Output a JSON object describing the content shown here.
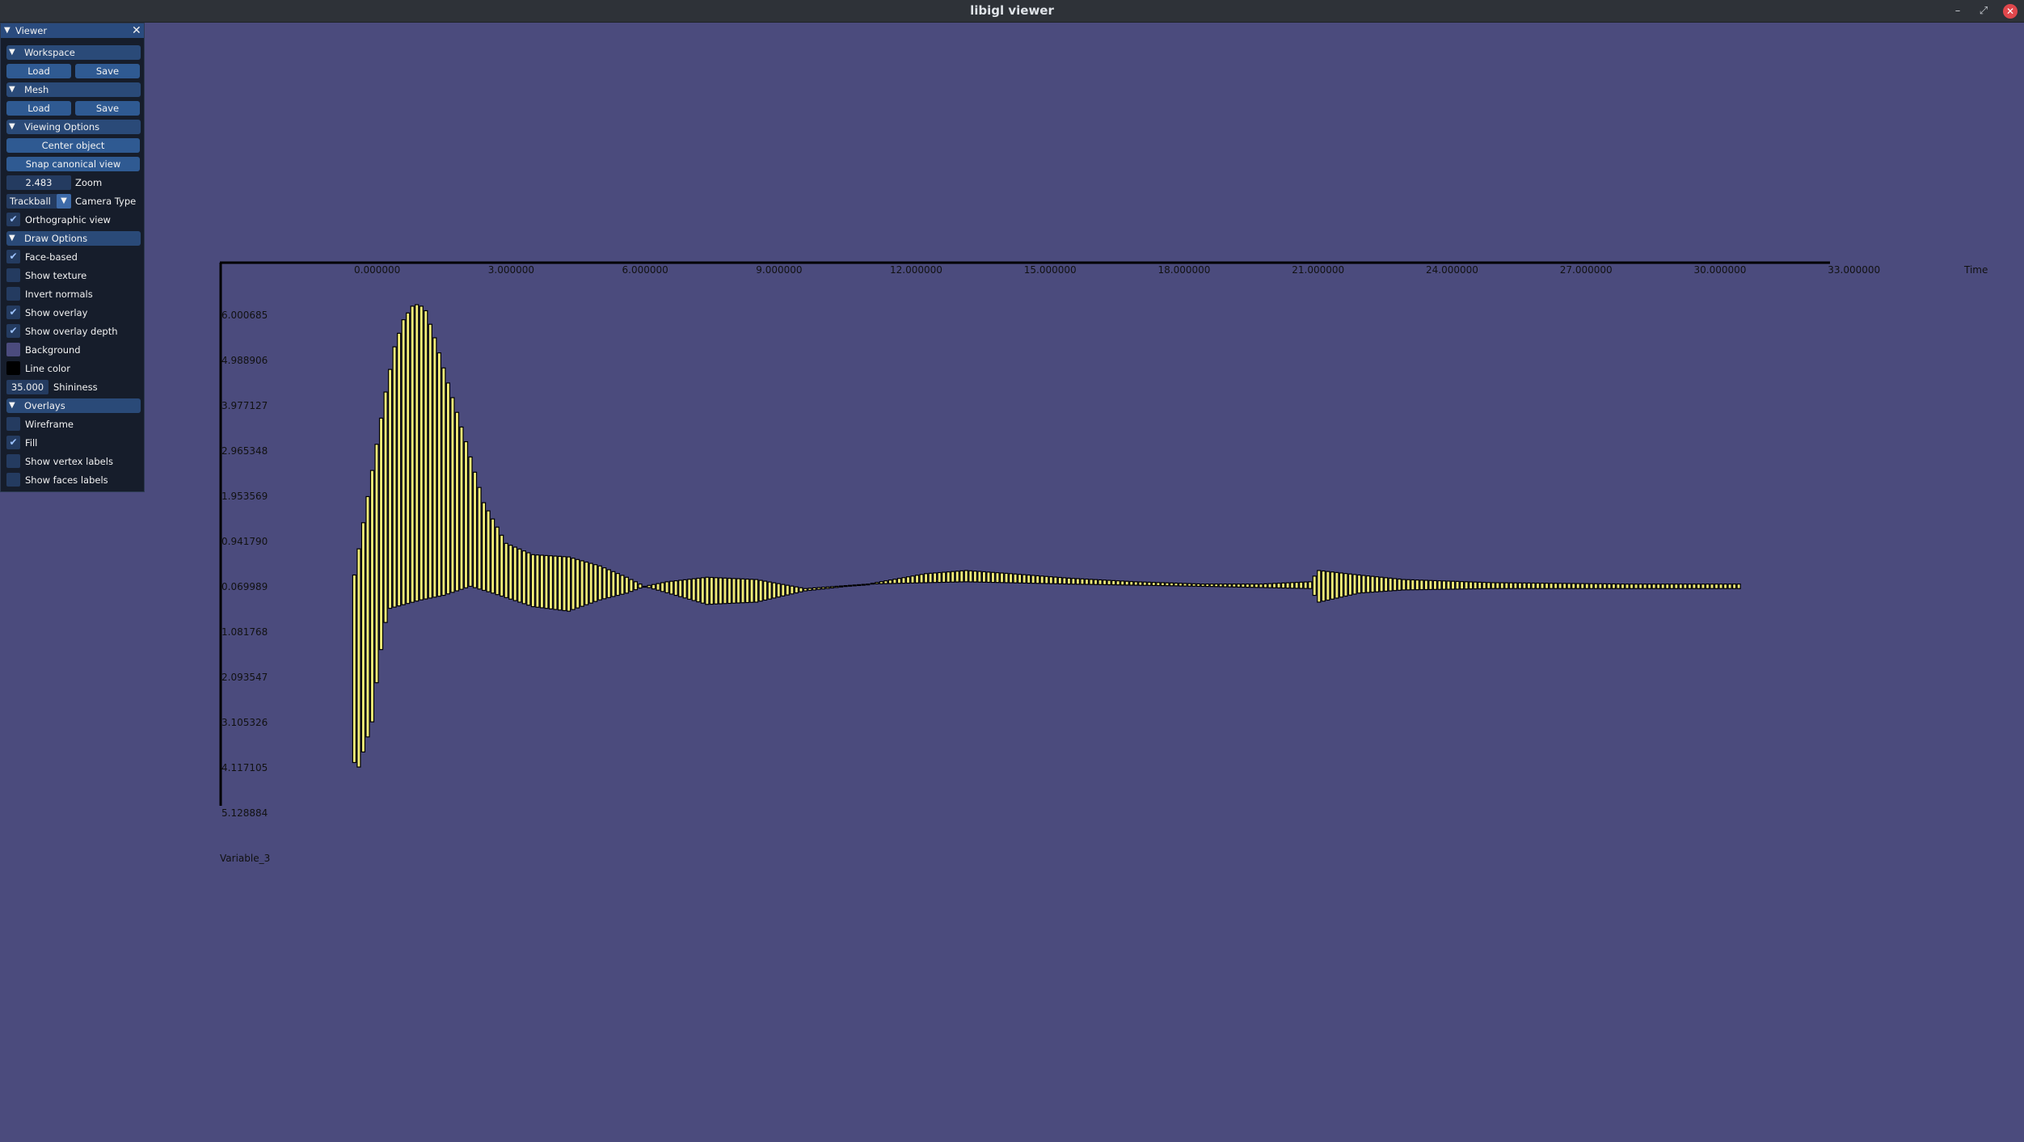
{
  "window": {
    "title": "libigl viewer",
    "minimize_glyph": "–",
    "maximize_glyph": "⤢",
    "close_glyph": "✕"
  },
  "panel": {
    "title": "Viewer",
    "close_glyph": "✕",
    "sections": {
      "workspace": {
        "label": "Workspace",
        "load": "Load",
        "save": "Save"
      },
      "mesh": {
        "label": "Mesh",
        "load": "Load",
        "save": "Save"
      },
      "viewing": {
        "label": "Viewing Options",
        "center": "Center object",
        "snap": "Snap canonical view",
        "zoom_value": "2.483",
        "zoom_label": "Zoom",
        "camera_value": "Trackball",
        "camera_label": "Camera Type",
        "ortho_label": "Orthographic view",
        "ortho_checked": true
      },
      "draw": {
        "label": "Draw Options",
        "face_based": "Face-based",
        "face_based_checked": true,
        "show_texture": "Show texture",
        "show_texture_checked": false,
        "invert_normals": "Invert normals",
        "invert_normals_checked": false,
        "show_overlay": "Show overlay",
        "show_overlay_checked": true,
        "show_overlay_depth": "Show overlay depth",
        "show_overlay_depth_checked": true,
        "background": "Background",
        "background_color": "#4b4b7d",
        "line_color": "Line color",
        "line_color_value": "#000000",
        "shininess_value": "35.000",
        "shininess_label": "Shininess"
      },
      "overlays": {
        "label": "Overlays",
        "wireframe": "Wireframe",
        "wireframe_checked": false,
        "fill": "Fill",
        "fill_checked": true,
        "vertex_labels": "Show vertex labels",
        "vertex_labels_checked": false,
        "faces_labels": "Show faces labels",
        "faces_labels_checked": false
      }
    }
  },
  "chart_data": {
    "type": "bar",
    "xlabel": "Time",
    "ylabel": "Variable_3",
    "x_ticks": [
      "0.000000",
      "3.000000",
      "6.000000",
      "9.000000",
      "12.000000",
      "15.000000",
      "18.000000",
      "21.000000",
      "24.000000",
      "27.000000",
      "30.000000",
      "33.000000"
    ],
    "y_ticks": [
      "6.000685",
      "4.988906",
      "3.977127",
      "2.965348",
      "1.953569",
      "0.941790",
      "0.069989",
      "1.081768",
      "2.093547",
      "3.105326",
      "4.117105",
      "5.128884"
    ],
    "xlim": [
      -3.5,
      33.0
    ],
    "ylim": [
      -5.128884,
      7.012464
    ],
    "bar_color": "#f5f07a",
    "edge_color": "#000000",
    "envelope_upper": [
      [
        -0.5,
        0.25
      ],
      [
        0.2,
        4.3
      ],
      [
        0.4,
        5.3
      ],
      [
        0.6,
        5.9
      ],
      [
        0.8,
        6.2
      ],
      [
        0.95,
        6.25
      ],
      [
        1.1,
        6.1
      ],
      [
        1.3,
        5.5
      ],
      [
        1.6,
        4.5
      ],
      [
        2.0,
        3.2
      ],
      [
        2.4,
        1.85
      ],
      [
        2.9,
        0.95
      ],
      [
        3.5,
        0.7
      ],
      [
        4.3,
        0.65
      ],
      [
        5.0,
        0.45
      ],
      [
        5.6,
        0.2
      ],
      [
        6.0,
        0.0
      ],
      [
        6.5,
        0.1
      ],
      [
        7.4,
        0.2
      ],
      [
        8.5,
        0.15
      ],
      [
        9.6,
        -0.05
      ],
      [
        11.0,
        0.05
      ],
      [
        12.3,
        0.28
      ],
      [
        13.2,
        0.35
      ],
      [
        14.2,
        0.28
      ],
      [
        15.5,
        0.18
      ],
      [
        17.0,
        0.1
      ],
      [
        18.5,
        0.05
      ],
      [
        19.8,
        0.05
      ],
      [
        20.9,
        0.1
      ],
      [
        21.1,
        0.35
      ],
      [
        22.0,
        0.25
      ],
      [
        23.0,
        0.15
      ],
      [
        25.0,
        0.08
      ],
      [
        28.0,
        0.05
      ],
      [
        30.5,
        0.05
      ]
    ],
    "envelope_lower": [
      [
        -0.5,
        -3.9
      ],
      [
        -0.4,
        -4.0
      ],
      [
        -0.1,
        -3.0
      ],
      [
        0.05,
        -1.7
      ],
      [
        0.25,
        -0.5
      ],
      [
        1.0,
        -0.3
      ],
      [
        1.5,
        -0.2
      ],
      [
        2.1,
        0.0
      ],
      [
        2.6,
        -0.15
      ],
      [
        3.5,
        -0.45
      ],
      [
        4.3,
        -0.55
      ],
      [
        5.0,
        -0.3
      ],
      [
        5.6,
        -0.15
      ],
      [
        6.0,
        0.0
      ],
      [
        7.4,
        -0.4
      ],
      [
        8.5,
        -0.35
      ],
      [
        9.6,
        -0.1
      ],
      [
        11.0,
        0.05
      ],
      [
        13.2,
        0.1
      ],
      [
        15.5,
        0.05
      ],
      [
        18.5,
        0.0
      ],
      [
        20.9,
        -0.05
      ],
      [
        21.1,
        -0.35
      ],
      [
        22.0,
        -0.15
      ],
      [
        23.0,
        -0.08
      ],
      [
        25.0,
        -0.05
      ],
      [
        30.5,
        -0.05
      ]
    ]
  }
}
